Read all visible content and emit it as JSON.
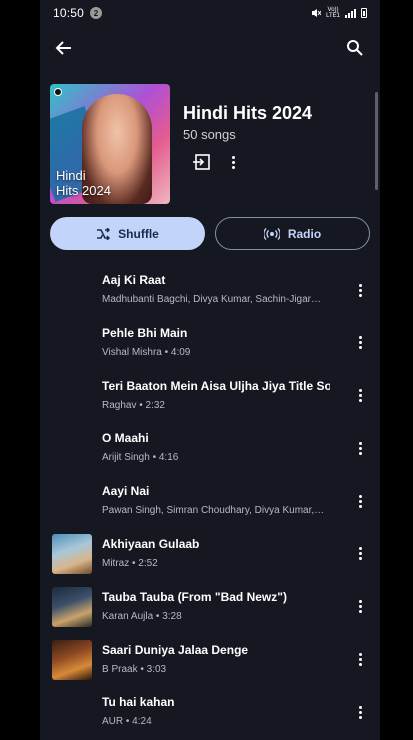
{
  "status": {
    "time": "10:50",
    "notif_count": "2",
    "net_top": "Vo))",
    "net_bottom": "LTE1"
  },
  "playlist": {
    "title": "Hindi Hits 2024",
    "count": "50 songs",
    "cover_line1": "Hindi",
    "cover_line2": "Hits 2024"
  },
  "buttons": {
    "shuffle": "Shuffle",
    "radio": "Radio"
  },
  "icons": [
    "back-arrow-icon",
    "search-icon",
    "save-to-library-icon",
    "more-vert-icon",
    "shuffle-icon",
    "radio-icon"
  ],
  "colors": {
    "background": "#161821",
    "shuffle_bg": "#c2d4fa",
    "accent": "#c2d4fa"
  },
  "tracks": [
    {
      "title": "Aaj Ki Raat",
      "subtitle": "Madhubanti Bagchi, Divya Kumar, Sachin-Jigar…",
      "has_thumb": false
    },
    {
      "title": "Pehle Bhi Main",
      "subtitle": "Vishal Mishra • 4:09",
      "has_thumb": false
    },
    {
      "title": "Teri Baaton Mein Aisa Uljha Jiya Title Sor",
      "subtitle": "Raghav • 2:32",
      "has_thumb": false
    },
    {
      "title": "O Maahi",
      "subtitle": "Arijit Singh • 4:16",
      "has_thumb": false
    },
    {
      "title": "Aayi Nai",
      "subtitle": "Pawan Singh, Simran Choudhary, Divya Kumar,…",
      "has_thumb": false
    },
    {
      "title": "Akhiyaan Gulaab",
      "subtitle": "Mitraz • 2:52",
      "has_thumb": true
    },
    {
      "title": "Tauba Tauba (From \"Bad Newz\")",
      "subtitle": "Karan Aujla • 3:28",
      "has_thumb": true
    },
    {
      "title": "Saari Duniya Jalaa Denge",
      "subtitle": "B Praak • 3:03",
      "has_thumb": true
    },
    {
      "title": "Tu hai kahan",
      "subtitle": "AUR • 4:24",
      "has_thumb": false
    }
  ]
}
